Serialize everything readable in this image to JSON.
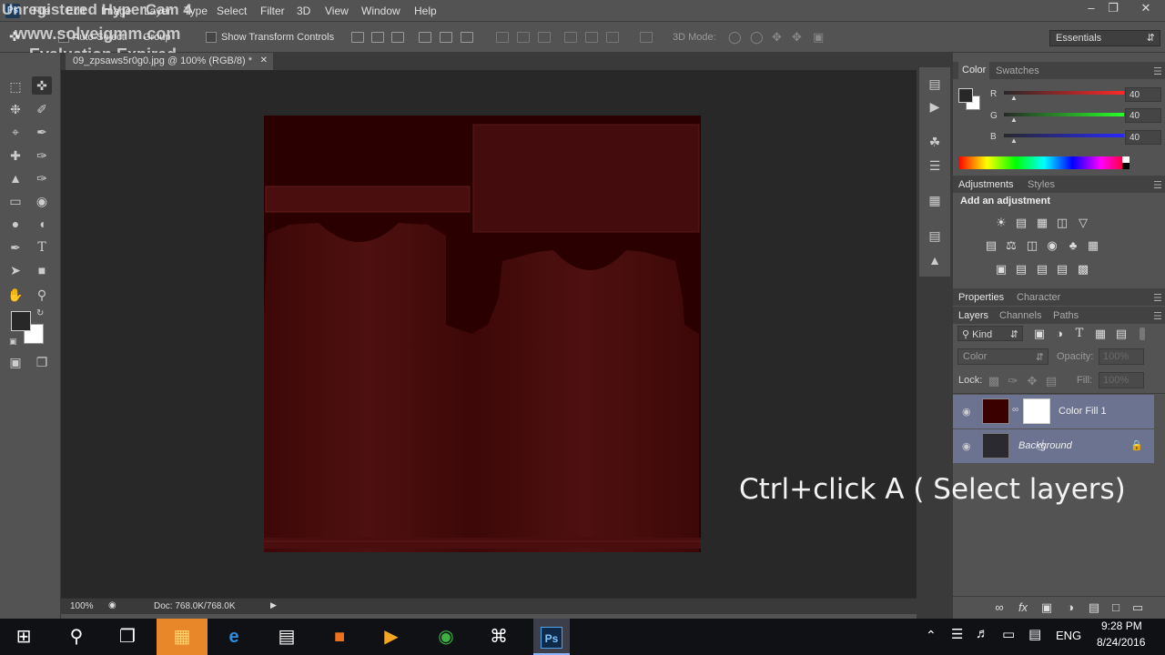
{
  "watermark": {
    "line1": "Unregistered HyperCam 4",
    "line2": "www.solveigmm.com",
    "line3": "Evaluation Expired"
  },
  "menu": [
    "File",
    "Edit",
    "Image",
    "Layer",
    "Type",
    "Select",
    "Filter",
    "3D",
    "View",
    "Window",
    "Help"
  ],
  "options": {
    "auto_select": "Auto-Select:",
    "group": "Group",
    "show_transform": "Show Transform Controls",
    "mode_3d": "3D Mode:",
    "workspace": "Essentials"
  },
  "document": {
    "tab_title": "09_zpsaws5r0g0.jpg @ 100% (RGB/8) *",
    "zoom": "100%",
    "doc_size": "Doc: 768.0K/768.0K"
  },
  "color_panel": {
    "tabs": [
      "Color",
      "Swatches"
    ],
    "r_label": "R",
    "g_label": "G",
    "b_label": "B",
    "r": "40",
    "g": "40",
    "b": "40"
  },
  "adjustments_panel": {
    "tabs": [
      "Adjustments",
      "Styles"
    ],
    "heading": "Add an adjustment"
  },
  "properties_panel": {
    "tabs": [
      "Properties",
      "Character"
    ]
  },
  "layers_panel": {
    "tabs": [
      "Layers",
      "Channels",
      "Paths"
    ],
    "filter_kind": "Kind",
    "blend_mode": "Color",
    "opacity_label": "Opacity:",
    "opacity_value": "100%",
    "lock_label": "Lock:",
    "fill_label": "Fill:",
    "fill_value": "100%",
    "layers": [
      {
        "name": "Color Fill 1"
      },
      {
        "name": "Background"
      }
    ]
  },
  "caption": "Ctrl+click A ( Select layers)",
  "taskbar": {
    "time": "9:28 PM",
    "date": "8/24/2016",
    "lang": "ENG"
  },
  "colors": {
    "ui_bg": "#535353",
    "panel_dark": "#3a3a3a",
    "canvas_bg": "#282828",
    "doc_red": "#4a0a0a",
    "selected_layer": "#6c7390",
    "taskbar": "#101114"
  }
}
